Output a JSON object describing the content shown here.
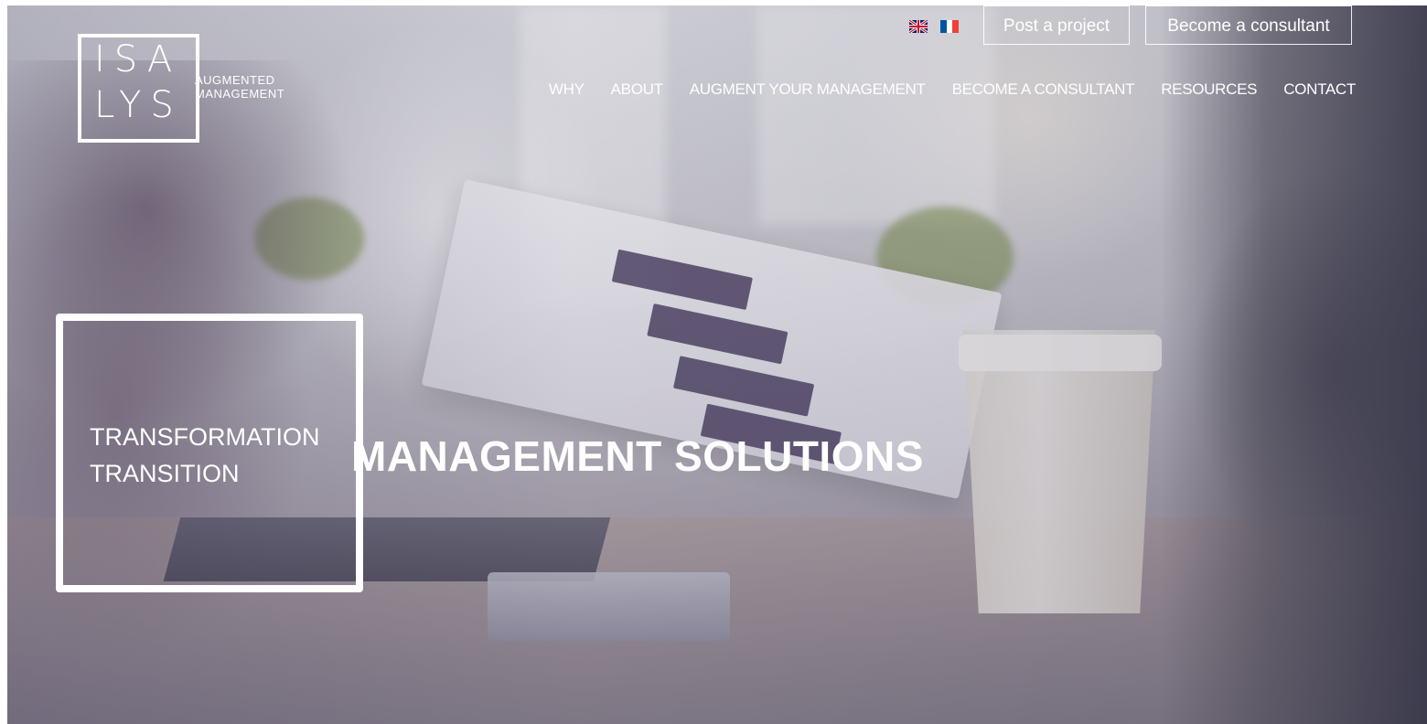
{
  "logo": {
    "line1": "ISA",
    "line2": "LYS",
    "tagline_1": "AUGMENTED",
    "tagline_2": "MANAGEMENT"
  },
  "languages": [
    {
      "code": "en",
      "icon": "uk-flag-icon"
    },
    {
      "code": "fr",
      "icon": "fr-flag-icon"
    }
  ],
  "header_buttons": {
    "post_project": "Post a project",
    "become_consultant": "Become a consultant"
  },
  "nav": {
    "items": [
      {
        "label": "WHY"
      },
      {
        "label": "ABOUT"
      },
      {
        "label": "AUGMENT YOUR MANAGEMENT"
      },
      {
        "label": "BECOME A CONSULTANT"
      },
      {
        "label": "RESOURCES"
      },
      {
        "label": "CONTACT"
      }
    ]
  },
  "hero": {
    "subtitle_line1": "TRANSFORMATION",
    "subtitle_line2": "TRANSITION",
    "title": "MANAGEMENT SOLUTIONS"
  },
  "colors": {
    "text": "#ffffff",
    "uk_blue": "#012169",
    "uk_red": "#C8102E",
    "fr_blue": "#0055A4",
    "fr_red": "#EF4135"
  }
}
